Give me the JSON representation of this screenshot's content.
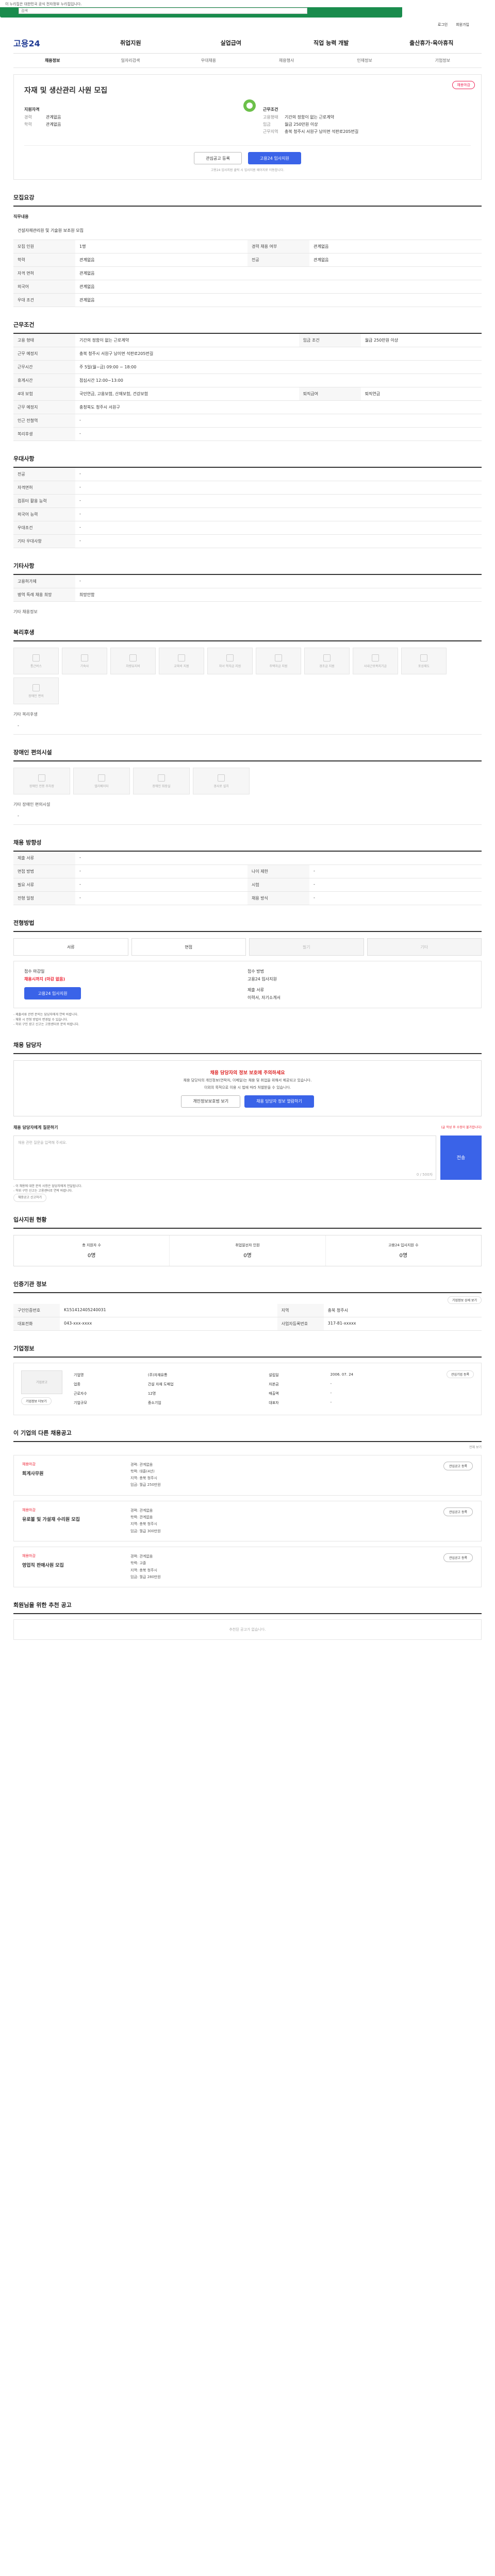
{
  "banner": "이 누리집은 대한민국 공식 전자정부 누리집입니다.",
  "search": {
    "placeholder": "검색"
  },
  "header": {
    "util": [
      "로그인",
      "회원가입"
    ]
  },
  "brand": "고용24",
  "gnb": [
    "취업지원",
    "실업급여",
    "직업 능력 개발",
    "출산휴가·육아휴직"
  ],
  "subnav": [
    "채용정보",
    "일자리검색",
    "우대채용",
    "채용행사",
    "인재정보",
    "기업정보"
  ],
  "job": {
    "badge": "채용마감",
    "title": "자재 및 생산관리 사원 모집",
    "head_left": "지원자격",
    "career": "경력",
    "career_v": "관계없음",
    "edu": "학력",
    "edu_v": "관계없음",
    "head_right": "근무조건",
    "work_type": "고용형태",
    "work_type_v": "기간의 정함이 없는 근로계약",
    "wage": "임금",
    "wage_v": "월급 250만원 이상",
    "place": "근무지역",
    "place_v": "충북 청주시 서원구 남이면 석판로205번길",
    "logo_label": "기업로고",
    "btn_scrap": "관심공고 등록",
    "btn_apply": "고용24 입사지원",
    "note": "고용24 입사지원 클릭 시 입사지원 페이지로 이동합니다."
  },
  "summary": {
    "title": "모집요강",
    "duty_label": "직무내용",
    "duty_value": "건설자재관리원 및 기술원 보조원 모집",
    "rows": [
      [
        "모집 인원",
        "1명",
        "경력 채용 여부",
        "관계없음"
      ],
      [
        "학력",
        "관계없음",
        "전공",
        "관계없음"
      ],
      [
        "자격 면허",
        "관계없음",
        "",
        ""
      ],
      [
        "외국어",
        "관계없음",
        "",
        ""
      ],
      [
        "우대 조건",
        "관계없음",
        "",
        ""
      ]
    ]
  },
  "work": {
    "title": "근무조건",
    "rows": [
      [
        "고용 형태",
        "기간의 정함이 없는 근로계약",
        "임금 조건",
        "월급 250만원 이상"
      ],
      [
        "근무 예정지",
        "충북 청주시 서원구 남이면 석판로205번길",
        "",
        ""
      ],
      [
        "근무시간",
        "주 5일(월~금) 09:00 ~ 18:00",
        "",
        ""
      ],
      [
        "휴게시간",
        "점심시간 12:00~13:00",
        "",
        ""
      ],
      [
        "4대 보험",
        "국민연금, 고용보험, 산재보험, 건강보험",
        "퇴직급여",
        "퇴직연금"
      ],
      [
        "근무 예정지",
        "충청북도 청주시 서원구",
        "",
        ""
      ],
      [
        "인근 전철역",
        "-",
        "",
        ""
      ],
      [
        "복리후생",
        "-",
        "",
        ""
      ]
    ]
  },
  "preference": {
    "title": "우대사항",
    "rows": [
      [
        "전공",
        "-"
      ],
      [
        "자격면허",
        "-"
      ],
      [
        "컴퓨터 활용 능력",
        "-"
      ],
      [
        "외국어 능력",
        "-"
      ],
      [
        "우대조건",
        "-"
      ],
      [
        "기타 우대사항",
        "-"
      ]
    ]
  },
  "other": {
    "title": "기타사항",
    "rows": [
      [
        "고용허가제",
        "-"
      ],
      [
        "병역 특례 채용 희망",
        "희망안함"
      ]
    ],
    "etc": "기타 채용정보"
  },
  "welfare": {
    "title": "복리후생",
    "items": [
      "통근버스",
      "기숙사",
      "차량유지비",
      "교육비 지원",
      "자녀 학자금 지원",
      "주택자금 지원",
      "경조금 지원",
      "사내근로복지기금",
      "포상제도",
      "장애인 편의"
    ],
    "etc_label": "기타 복리후생",
    "etc_value": "-"
  },
  "disabled": {
    "title": "장애인 편의시설",
    "items": [
      "장애인 전용 주차장",
      "엘리베이터",
      "장애인 화장실",
      "경사로 설치"
    ],
    "etc_label": "기타 장애인 편의시설",
    "etc_value": "-"
  },
  "hire_cond": {
    "title": "채용 방향성",
    "rows": [
      [
        "제출 서류",
        "-",
        "",
        ""
      ],
      [
        "면접 방법",
        "-",
        "나이 제한",
        "-"
      ],
      [
        "필요 서류",
        "-",
        "시험",
        "-"
      ],
      [
        "전형 일정",
        "-",
        "채용 방식",
        "-"
      ]
    ]
  },
  "method": {
    "title": "전형방법",
    "items": [
      "서류",
      "면접",
      "필기",
      "기타"
    ],
    "apply_label": "접수 마감일",
    "apply_value": "채용시까지 (마감 없음)",
    "doc_label": "접수 방법",
    "doc_value": "고용24 입사지원",
    "doc_label2": "제출 서류",
    "doc_value2": "이력서, 자기소개서",
    "btn": "고용24 입사지원",
    "bullets": [
      "- 제출서류 관련 문의는 담당자에게 연락 바랍니다.",
      "- 채용 시 전형 방법이 변경될 수 있습니다.",
      "- 허위 구인 광고 신고는 고용센터로 문의 바랍니다."
    ]
  },
  "contact": {
    "title": "채용 담당자",
    "warn_title": "채용 담당자의 정보 보호에 주의하세요",
    "warn_lines": [
      "채용 담당자의 개인정보(연락처, 이메일)는 채용 및 취업을 위해서 제공되고 있습니다.",
      "이외의 목적으로 이용 시 법에 따라 처벌받을 수 있습니다."
    ],
    "btn1": "개인정보보호법 보기",
    "btn2": "채용 담당자 정보 열람하기",
    "inq_title": "채용 담당자에게 질문하기",
    "inq_note": "(글 작성 후 수정이 불가합니다)",
    "inq_placeholder": "채용 관련 질문을 입력해 주세요.",
    "inq_count": "0 / 500자",
    "inq_btn": "전송",
    "bullets": [
      "- 이 채용에 대한 문의 사항은 담당자에게 전달됩니다.",
      "- 허위 구인 신고는 고용센터로 연락 바랍니다."
    ],
    "report_btn": "채용공고 신고하기"
  },
  "stats": {
    "title": "입사지원 현황",
    "items": [
      [
        "총 지원자 수",
        "0명"
      ],
      [
        "취업알선자 인원",
        "0명"
      ],
      [
        "고용24 입사지원 수",
        "0명"
      ]
    ]
  },
  "info": {
    "title": "인증기관 정보",
    "btn": "기업정보 상세 보기",
    "rows": [
      [
        "구인인증번호",
        "K151412405240031",
        "지역",
        "충북 청주시"
      ],
      [
        "대표전화",
        "043-xxx-xxxx",
        "사업자등록번호",
        "317-81-xxxxx"
      ]
    ]
  },
  "company": {
    "title": "기업정보",
    "logo": "기업로고",
    "btn1": "기업정보 더보기",
    "btn2": "관심기업 등록",
    "rows": [
      [
        "기업명",
        "(주)자재유통",
        "설립일",
        "2006. 07. 24"
      ],
      [
        "업종",
        "건설 자재 도매업",
        "자본금",
        "-"
      ],
      [
        "근로자수",
        "12명",
        "매출액",
        "-"
      ],
      [
        "기업규모",
        "중소기업",
        "대표자",
        "-"
      ]
    ]
  },
  "others": {
    "title": "이 기업의 다른 채용공고",
    "more": "전체 보기",
    "jobs": [
      {
        "co": "채용마감",
        "title": "회계사무원",
        "lines": [
          "경력: 관계없음",
          "학력: 대졸(4년)",
          "지역: 충북 청주시",
          "임금: 월급 250만원"
        ],
        "btn": "관심공고 등록"
      },
      {
        "co": "채용마감",
        "title": "유로볼 및 가설재 수리원 모집",
        "lines": [
          "경력: 관계없음",
          "학력: 관계없음",
          "지역: 충북 청주시",
          "임금: 월급 300만원"
        ],
        "btn": "관심공고 등록"
      },
      {
        "co": "채용마감",
        "title": "영업직 판매사원 모집",
        "lines": [
          "경력: 관계없음",
          "학력: 고졸",
          "지역: 충북 청주시",
          "임금: 월급 280만원"
        ],
        "btn": "관심공고 등록"
      }
    ]
  },
  "recommend": {
    "title": "회원님을 위한 추천 공고",
    "empty": "추천된 공고가 없습니다."
  }
}
